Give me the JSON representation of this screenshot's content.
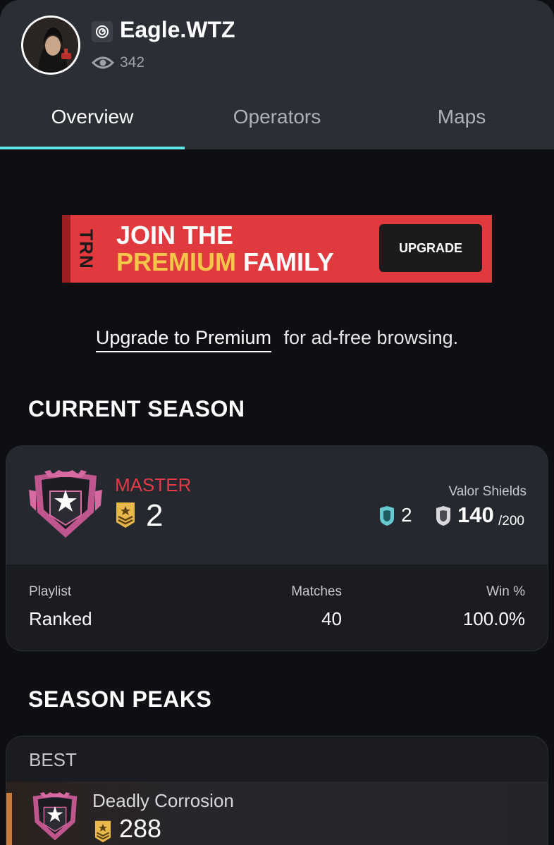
{
  "profile": {
    "username": "Eagle.WTZ",
    "views": "342",
    "platform_icon": "ubisoft-swirl-icon"
  },
  "tabs": [
    {
      "label": "Overview",
      "active": true
    },
    {
      "label": "Operators",
      "active": false
    },
    {
      "label": "Maps",
      "active": false
    }
  ],
  "ad": {
    "logo": "TRN",
    "line1": "JOIN THE",
    "line2_highlight": "PREMIUM",
    "line2_rest": "FAMILY",
    "button": "UPGRADE"
  },
  "premium": {
    "link": "Upgrade to Premium",
    "text": "for ad-free browsing."
  },
  "current_season": {
    "title": "CURRENT SEASON",
    "rank": "MASTER",
    "rank_level": "2",
    "valor_label": "Valor Shields",
    "valor_teal": "2",
    "valor_silver": "140",
    "valor_silver_max": "/200",
    "columns": {
      "playlist_label": "Playlist",
      "playlist_value": "Ranked",
      "matches_label": "Matches",
      "matches_value": "40",
      "win_label": "Win %",
      "win_value": "100.0%"
    }
  },
  "season_peaks": {
    "title": "SEASON PEAKS",
    "best_label": "BEST",
    "name": "Deadly Corrosion",
    "value": "288"
  },
  "colors": {
    "accent_tab": "#5fe6e8",
    "rank_red": "#e23a47",
    "ad_red": "#e03a3e",
    "gold": "#f4c64a"
  }
}
